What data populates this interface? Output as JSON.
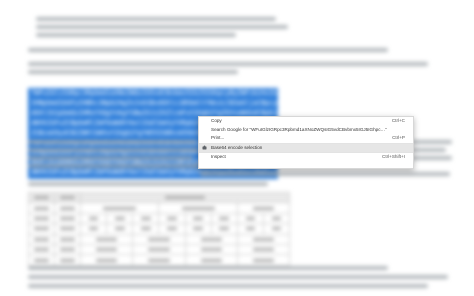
{
  "code_block": {
    "lines": [
      "TWFuIGlzIGRpc3Rpbmd1aXNoZWQsIG5vdCBvbmx5IGJ5IGhpcyByZWFzb24sIGJ1dCBieSB0aGlz",
      "IHNpbmd1bGFyIHBhc3Npb24gZnJvbSBvdGhlciBhbmltYWxzLCB3aGljaCBpcyBhIGx1c3Qgb2Yg",
      "dGhlIG1pbmQsIHRoYXQgYnkgYSBwZXJzZXZlcmFuY2Ugb2YgZGVsaWdodCBpbiB0aGUgY29udGlu",
      "dWVkIGFuZCBpbmRlZmF0aWdhYmxlIGdlbmVyYXRpb24gb2Yga25vd2xlZGdlLCBleGNlZWRzIHRo",
      "ZSBzaG9ydCB2ZWhlbWVuY2Ugb2YgYW55IGNhcm5hbCBwbGVhc3VyZS4=",
      "TWFuIGlzIGRpc3Rpbmd1aXNoZWQsIG5vdCBvbmx5IGJ5IGhpcyByZWFzb24sIGJ1dCBieSB0aGlz",
      "IHNpbmd1bGFyIHBhc3Npb24gZnJvbSBvdGhlciBhbmltYWxzLCB3aGljaCBpcyBhIGx1c3Qgb2Yg",
      "dGhlIG1pbmQsIHRoYXQgYnkgYSBwZXJzZXZlcmFuY2Ugb2YgZGVsaWdodCBpbiB0aGUgY29udGlu",
      "dWVkIGFuZCBpbmRlZmF0aWdhYmxlIGdlbmVyYXRpb24gb2Yga25vd2xlZGdlLCBleGNlZWRzIHRo"
    ]
  },
  "context_menu": {
    "copy": {
      "label": "Copy",
      "shortcut": "Ctrl+C"
    },
    "search": {
      "label": "Search Google for “WFuIGlzIGRpc3Rpbmd1aXNoZWQsIG5vdCBvbmx5IGJ5IGhpc…”"
    },
    "print": {
      "label": "Print...",
      "shortcut": "Ctrl+P"
    },
    "base64": {
      "label": "Base64 encode selection",
      "icon": "extension-icon"
    },
    "inspect": {
      "label": "Inspect",
      "shortcut": "Ctrl+Shift+I"
    }
  },
  "colors": {
    "selection": "#2f7fdb",
    "menu_highlight": "#e6e6e6",
    "background": "#ffffff"
  }
}
